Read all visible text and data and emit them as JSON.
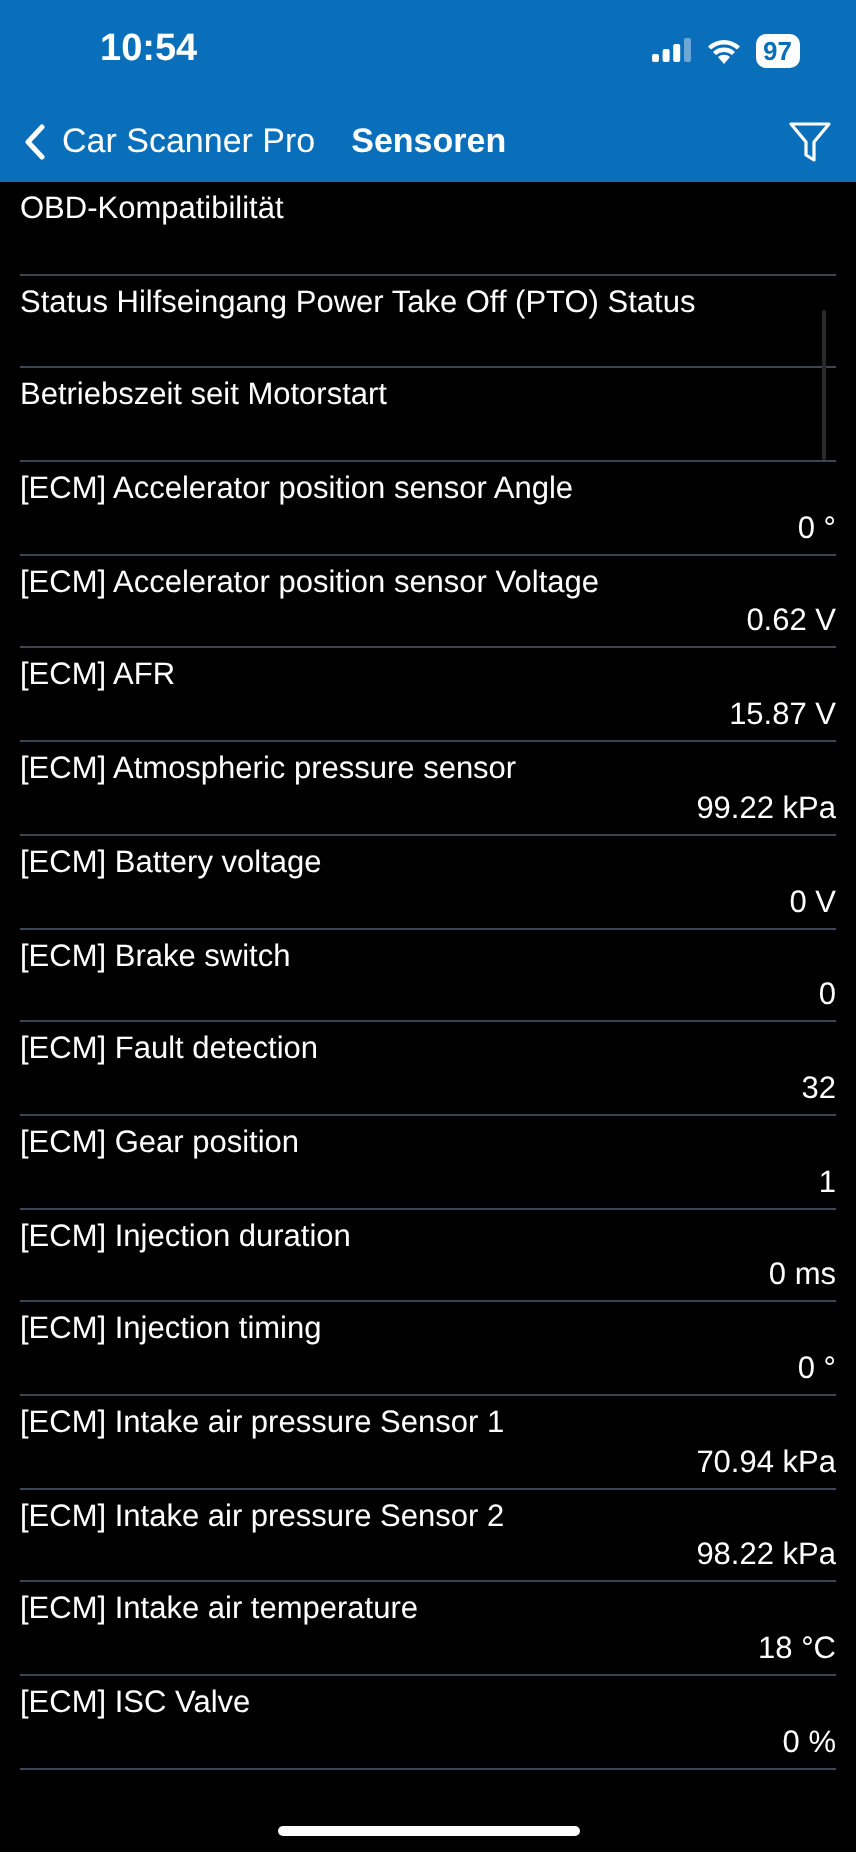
{
  "status_bar": {
    "time": "10:54",
    "battery": "97"
  },
  "nav_bar": {
    "back_label": "Car Scanner Pro",
    "title": "Sensoren"
  },
  "sensors": [
    {
      "name": "OBD-Kompatibilität"
    },
    {
      "name": "Status Hilfseingang Power Take Off (PTO) Status"
    },
    {
      "name": "Betriebszeit seit Motorstart"
    },
    {
      "name": "[ECM] Accelerator position sensor Angle",
      "value": "0 °"
    },
    {
      "name": "[ECM] Accelerator position sensor Voltage",
      "value": "0.62 V"
    },
    {
      "name": "[ECM] AFR",
      "value": "15.87 V"
    },
    {
      "name": "[ECM] Atmospheric pressure sensor",
      "value": "99.22 kPa"
    },
    {
      "name": "[ECM] Battery voltage",
      "value": "0 V"
    },
    {
      "name": "[ECM] Brake switch",
      "value": "0"
    },
    {
      "name": "[ECM] Fault detection",
      "value": "32"
    },
    {
      "name": "[ECM] Gear position",
      "value": "1"
    },
    {
      "name": "[ECM] Injection duration",
      "value": "0 ms"
    },
    {
      "name": "[ECM] Injection timing",
      "value": "0 °"
    },
    {
      "name": "[ECM] Intake air pressure Sensor 1",
      "value": "70.94 kPa"
    },
    {
      "name": "[ECM] Intake air pressure Sensor 2",
      "value": "98.22 kPa"
    },
    {
      "name": "[ECM] Intake air temperature",
      "value": "18 °C"
    },
    {
      "name": "[ECM] ISC Valve",
      "value": "0 %"
    }
  ]
}
